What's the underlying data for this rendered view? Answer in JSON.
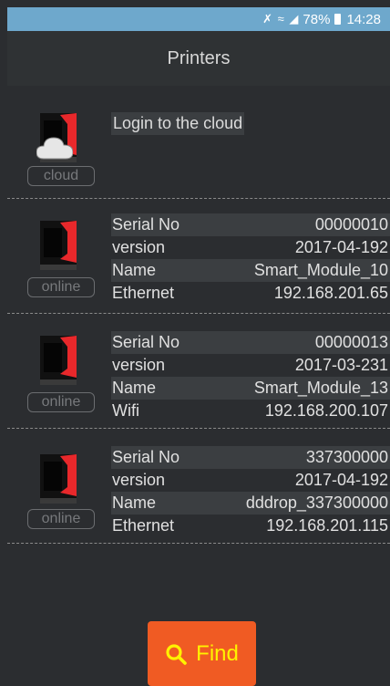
{
  "status_bar": {
    "battery": "78%",
    "time": "14:28"
  },
  "header": {
    "title": "Printers"
  },
  "cloud_item": {
    "text": "Login to the cloud",
    "badge": "cloud"
  },
  "printers": [
    {
      "badge": "online",
      "rows": [
        {
          "label": "Serial No",
          "value": "00000010"
        },
        {
          "label": "version",
          "value": "2017-04-192"
        },
        {
          "label": "Name",
          "value": "Smart_Module_10"
        },
        {
          "label": "Ethernet",
          "value": "192.168.201.65"
        }
      ]
    },
    {
      "badge": "online",
      "rows": [
        {
          "label": "Serial No",
          "value": "00000013"
        },
        {
          "label": "version",
          "value": "2017-03-231"
        },
        {
          "label": "Name",
          "value": "Smart_Module_13"
        },
        {
          "label": "Wifi",
          "value": "192.168.200.107"
        }
      ]
    },
    {
      "badge": "online",
      "rows": [
        {
          "label": "Serial No",
          "value": "337300000"
        },
        {
          "label": "version",
          "value": "2017-04-192"
        },
        {
          "label": "Name",
          "value": "dddrop_337300000"
        },
        {
          "label": "Ethernet",
          "value": "192.168.201.115"
        }
      ]
    }
  ],
  "find_button": {
    "label": "Find",
    "icon": "search-icon",
    "color": "#f05b23",
    "text_color": "#fff200"
  }
}
